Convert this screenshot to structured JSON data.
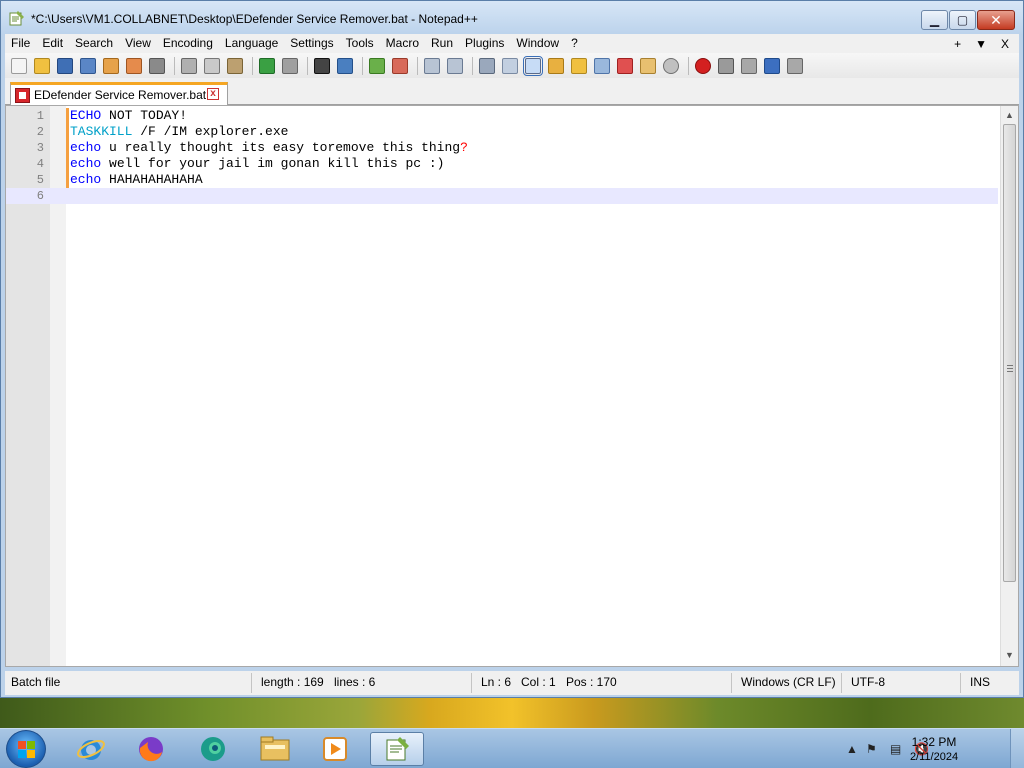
{
  "window": {
    "title": "*C:\\Users\\VM1.COLLABNET\\Desktop\\EDefender Service Remover.bat - Notepad++"
  },
  "menu": {
    "items": [
      "File",
      "Edit",
      "Search",
      "View",
      "Encoding",
      "Language",
      "Settings",
      "Tools",
      "Macro",
      "Run",
      "Plugins",
      "Window",
      "?"
    ],
    "right_plus": "+",
    "right_arrow": "▼",
    "right_close": "X"
  },
  "tab": {
    "label": "EDefender Service Remover.bat",
    "close": "x"
  },
  "editor": {
    "lines": [
      {
        "num": "1",
        "kw": "ECHO",
        "kwClass": "kw",
        "rest": " NOT TODAY!",
        "tail": ""
      },
      {
        "num": "2",
        "kw": "TASKKILL",
        "kwClass": "kw2",
        "rest": " /F /IM explorer.exe",
        "tail": ""
      },
      {
        "num": "3",
        "kw": "echo",
        "kwClass": "kw",
        "rest": " u really thought its easy toremove this thing",
        "tail": "?"
      },
      {
        "num": "4",
        "kw": "echo",
        "kwClass": "kw",
        "rest": " well for your jail im gonan kill this pc :)",
        "tail": ""
      },
      {
        "num": "5",
        "kw": "echo",
        "kwClass": "kw",
        "rest": " HAHAHAHAHAHA",
        "tail": ""
      },
      {
        "num": "6",
        "kw": "",
        "kwClass": "kw",
        "rest": "",
        "tail": ""
      }
    ],
    "current_line_index": 5
  },
  "status": {
    "file_type": "Batch file",
    "length": "length : 169",
    "lines": "lines : 6",
    "ln": "Ln : 6",
    "col": "Col : 1",
    "pos": "Pos : 170",
    "eol": "Windows (CR LF)",
    "encoding": "UTF-8",
    "mode": "INS"
  },
  "taskbar": {
    "apps": [
      "internet-explorer-icon",
      "firefox-icon",
      "edge-icon",
      "file-explorer-icon",
      "media-player-icon",
      "notepadpp-icon"
    ],
    "clock_time": "1:32 PM",
    "clock_date": "2/11/2024"
  },
  "colors": {
    "keyword": "#0000ff",
    "keyword2": "#00a0c8",
    "operator": "#ff0000",
    "change_bar": "#f5a040",
    "tab_accent": "#f5a623"
  }
}
